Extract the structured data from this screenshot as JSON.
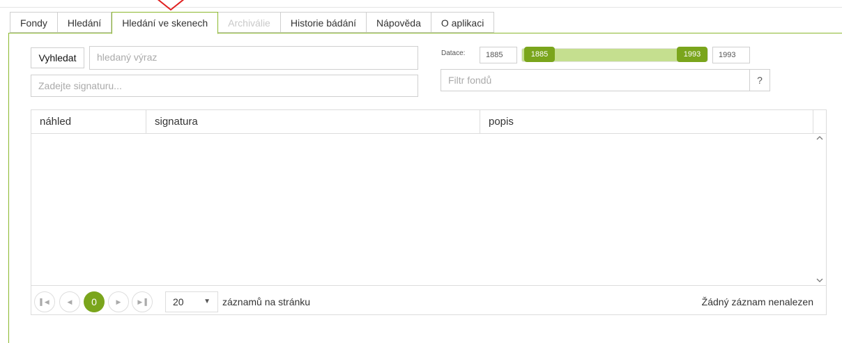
{
  "tabs": [
    {
      "label": "Fondy",
      "state": "normal"
    },
    {
      "label": "Hledání",
      "state": "normal"
    },
    {
      "label": "Hledání ve skenech",
      "state": "active"
    },
    {
      "label": "Archiválie",
      "state": "disabled"
    },
    {
      "label": "Historie bádání",
      "state": "normal"
    },
    {
      "label": "Nápověda",
      "state": "normal"
    },
    {
      "label": "O aplikaci",
      "state": "normal"
    }
  ],
  "search": {
    "button_label": "Vyhledat",
    "placeholder": "hledaný výraz",
    "signature_placeholder": "Zadejte signaturu..."
  },
  "dating": {
    "label": "Datace:",
    "min_value": "1885",
    "max_value": "1993",
    "slider_low": "1885",
    "slider_high": "1993"
  },
  "filter": {
    "placeholder": "Filtr fondů",
    "help_label": "?"
  },
  "grid": {
    "columns": [
      "náhled",
      "signatura",
      "popis"
    ],
    "rows": []
  },
  "pager": {
    "current_page": "0",
    "page_size": "20",
    "page_size_label": "záznamů na stránku",
    "status": "Žádný záznam nenalezen"
  },
  "colors": {
    "accent": "#7aa51c",
    "accent_light": "#c5df8f",
    "marker": "#e02020"
  },
  "icons": {
    "marker": "triangle-marker-icon",
    "scroll_up": "chevron-up-icon",
    "scroll_down": "chevron-down-icon",
    "first": "first-page-icon",
    "prev": "prev-page-icon",
    "next": "next-page-icon",
    "last": "last-page-icon",
    "dropdown": "caret-down-icon"
  }
}
